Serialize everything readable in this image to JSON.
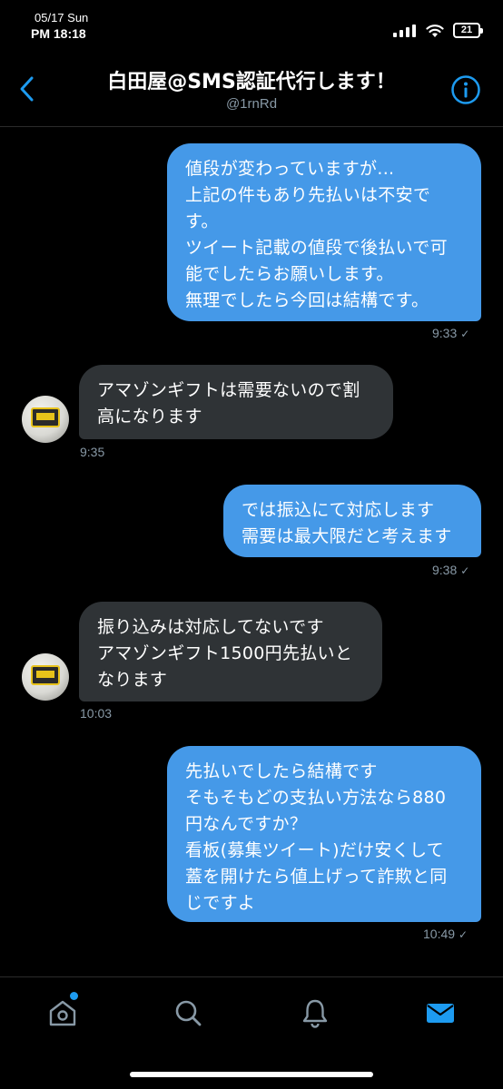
{
  "status": {
    "date": "05/17 Sun",
    "time": "PM 18:18",
    "battery": "21"
  },
  "header": {
    "title": "白田屋@SMS認証代行します！",
    "handle": "@1rnRd"
  },
  "messages": [
    {
      "direction": "outgoing",
      "lines": [
        "値段が変わっていますが...",
        "上記の件もあり先払いは不安で",
        "す。",
        "ツイート記載の値段で後払いで可",
        "能でしたらお願いします。",
        "無理でしたら今回は結構です。"
      ],
      "time": "9:33"
    },
    {
      "direction": "incoming",
      "lines": [
        "アマゾンギフトは需要ないので割",
        "高になります"
      ],
      "time": "9:35"
    },
    {
      "direction": "outgoing",
      "lines": [
        "では振込にて対応します",
        "需要は最大限だと考えます"
      ],
      "time": "9:38"
    },
    {
      "direction": "incoming",
      "lines": [
        "振り込みは対応してないです",
        "アマゾンギフト1500円先払いと",
        "なります"
      ],
      "time": "10:03"
    },
    {
      "direction": "outgoing",
      "lines": [
        "先払いでしたら結構です",
        "そもそもどの支払い方法なら880",
        "円なんですか？",
        "看板(募集ツイート)だけ安くして",
        "蓋を開けたら値上げって詐欺と同",
        "じですよ"
      ],
      "time": "10:49"
    }
  ],
  "read_mark": "✓",
  "colors": {
    "accent": "#1d9bf0",
    "outgoing_bubble": "#4599e8",
    "incoming_bubble": "#2f3336",
    "muted": "#8899a6"
  },
  "tabs": [
    {
      "icon": "home-icon",
      "has_notification_dot": true
    },
    {
      "icon": "search-icon"
    },
    {
      "icon": "bell-icon"
    },
    {
      "icon": "mail-icon",
      "active": true
    }
  ]
}
